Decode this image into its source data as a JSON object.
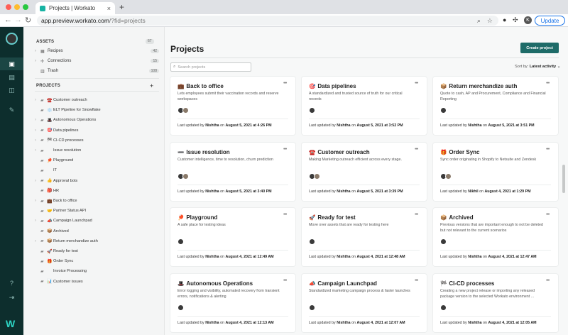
{
  "browser": {
    "tab_title": "Projects | Workato",
    "tab_close": "×",
    "new_tab": "+",
    "url_host": "app.preview.workato.com",
    "url_path": "/?fid=projects",
    "profile_initial": "K",
    "update_label": "Update",
    "dot_colors": [
      "#ff5f57",
      "#febc2e",
      "#28c840"
    ]
  },
  "sidebar": {
    "assets_header": "ASSETS",
    "assets_count": "67",
    "assets": [
      {
        "label": "Recipes",
        "count": "42",
        "icon": "recipe-icon"
      },
      {
        "label": "Connections",
        "count": "15",
        "icon": "connection-icon"
      },
      {
        "label": "Trash",
        "count": "108",
        "icon": "trash-icon"
      }
    ],
    "projects_header": "PROJECTS",
    "add_label": "+",
    "projects": [
      {
        "emoji": "☎️",
        "label": "Customer outreach",
        "chevron": true
      },
      {
        "emoji": "❄️",
        "label": "ELT Pipeline for Snowflake",
        "chevron": false
      },
      {
        "emoji": "🎩",
        "label": "Autonomous Operations",
        "chevron": true
      },
      {
        "emoji": "🎯",
        "label": "Data pipelines",
        "chevron": true
      },
      {
        "emoji": "🏁",
        "label": "CI-CD processes",
        "chevron": true
      },
      {
        "emoji": "",
        "label": "Issue resolution",
        "chevron": true
      },
      {
        "emoji": "🏓",
        "label": "Playground",
        "chevron": false
      },
      {
        "emoji": "",
        "label": "IT",
        "chevron": false
      },
      {
        "emoji": "👍",
        "label": "Approval bots",
        "chevron": true
      },
      {
        "emoji": "🎒",
        "label": "HR",
        "chevron": false
      },
      {
        "emoji": "💼",
        "label": "Back to office",
        "chevron": true
      },
      {
        "emoji": "🤝",
        "label": "Partner Status API",
        "chevron": false
      },
      {
        "emoji": "📣",
        "label": "Campaign Launchpad",
        "chevron": true
      },
      {
        "emoji": "📦",
        "label": "Archived",
        "chevron": false
      },
      {
        "emoji": "📦",
        "label": "Return merchandize auth",
        "chevron": true
      },
      {
        "emoji": "🚀",
        "label": "Ready for test",
        "chevron": false
      },
      {
        "emoji": "🎁",
        "label": "Order Sync",
        "chevron": false
      },
      {
        "emoji": "",
        "label": "Invoice Processing",
        "chevron": false
      },
      {
        "emoji": "📊",
        "label": "Customer issues",
        "chevron": false
      }
    ]
  },
  "main": {
    "title": "Projects",
    "create_label": "Create project",
    "search_placeholder": "Search projects",
    "sort_prefix": "Sort by:",
    "sort_value": "Latest activity ⌄",
    "more_label": "•••",
    "footer_prefix": "Last updated by",
    "footer_on": "on",
    "cards": [
      {
        "emoji": "💼",
        "title": "Back to office",
        "desc": "Lets employees submit their vaccination records and reserve workspaces",
        "avatars": 2,
        "user": "Nishtha",
        "date": "August 5, 2021 at 4:26 PM"
      },
      {
        "emoji": "🎯",
        "title": "Data pipelines",
        "desc": "A standardized and trusted source of truth for our critical records",
        "avatars": 1,
        "user": "Nishtha",
        "date": "August 5, 2021 at 3:52 PM"
      },
      {
        "emoji": "📦",
        "title": "Return merchandize auth",
        "desc": "Quote to cash, AP and Procurement, Compliance and Financial Reporting",
        "avatars": 1,
        "user": "Nishtha",
        "date": "August 5, 2021 at 3:51 PM"
      },
      {
        "emoji": "➖",
        "title": "Issue resolution",
        "desc": "Customer intelligence, time to resolution, churn prediction",
        "avatars": 2,
        "user": "Nishtha",
        "date": "August 5, 2021 at 3:40 PM"
      },
      {
        "emoji": "☎️",
        "title": "Customer outreach",
        "desc": "Making Marketing outreach efficient across every stage.",
        "avatars": 2,
        "user": "Nishtha",
        "date": "August 5, 2021 at 3:39 PM"
      },
      {
        "emoji": "🎁",
        "title": "Order Sync",
        "desc": "Sync order originating in Shopify to Netsuite and Zendesk",
        "avatars": 2,
        "user": "Nikhil",
        "date": "August 4, 2021 at 1:29 PM"
      },
      {
        "emoji": "🏓",
        "title": "Playground",
        "desc": "A safe place for testing ideas",
        "avatars": 1,
        "user": "Nishtha",
        "date": "August 4, 2021 at 12:49 AM"
      },
      {
        "emoji": "🚀",
        "title": "Ready for test",
        "desc": "Move over assets that are ready for testing here",
        "avatars": 1,
        "user": "Nishtha",
        "date": "August 4, 2021 at 12:48 AM"
      },
      {
        "emoji": "📦",
        "title": "Archived",
        "desc": "Previous versions that are important enough to not be deleted but not relevant to the current scenarios",
        "avatars": 1,
        "user": "Nishtha",
        "date": "August 4, 2021 at 12:47 AM"
      },
      {
        "emoji": "🎩",
        "title": "Autonomous Operations",
        "desc": "Error logging and visibility, automated recovery from transient errors, notifications & alerting",
        "avatars": 1,
        "user": "Nishtha",
        "date": "August 4, 2021 at 12:13 AM"
      },
      {
        "emoji": "📣",
        "title": "Campaign Launchpad",
        "desc": "Standardized marketing campaign process & faster launches",
        "avatars": 1,
        "user": "Nishtha",
        "date": "August 4, 2021 at 12:07 AM"
      },
      {
        "emoji": "🏁",
        "title": "CI-CD processes",
        "desc": "Creating a new project release or importing any released package version to the selected Workato environment ...",
        "avatars": 1,
        "user": "Nishtha",
        "date": "August 4, 2021 at 12:05 AM"
      }
    ]
  }
}
